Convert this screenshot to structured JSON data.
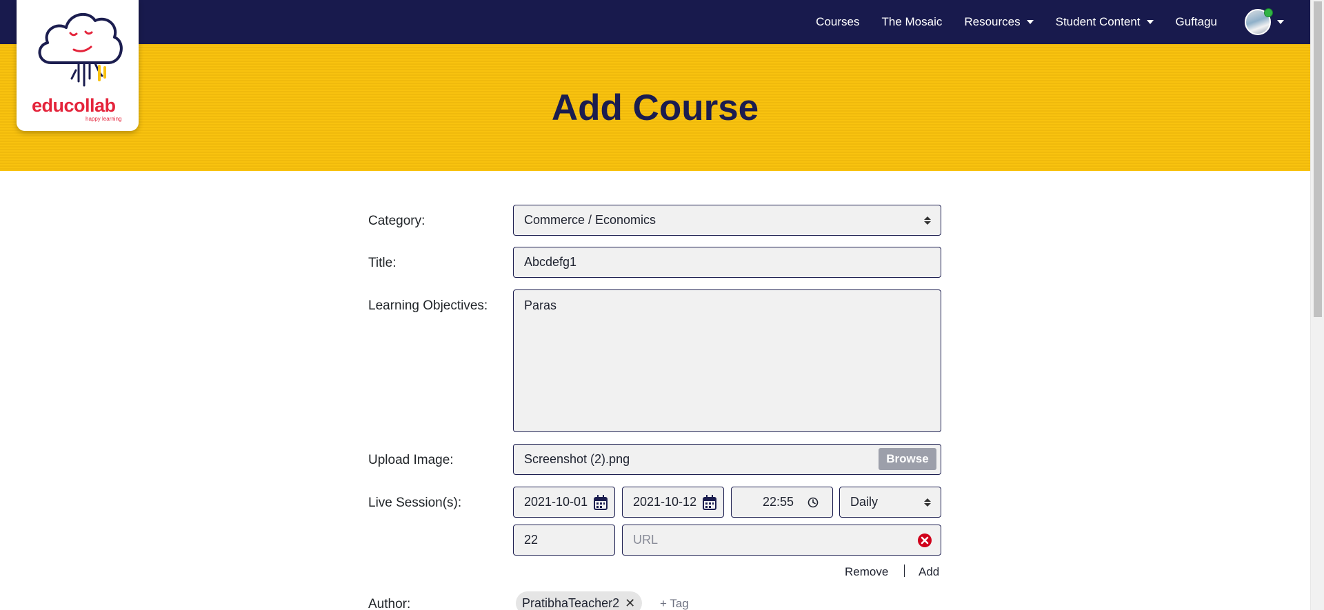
{
  "nav": {
    "items": [
      {
        "label": "Courses",
        "dropdown": false
      },
      {
        "label": "The Mosaic",
        "dropdown": false
      },
      {
        "label": "Resources",
        "dropdown": true
      },
      {
        "label": "Student Content",
        "dropdown": true
      },
      {
        "label": "Guftagu",
        "dropdown": false
      }
    ]
  },
  "logo": {
    "text": "educollab",
    "tagline": "happy learning"
  },
  "page": {
    "title": "Add Course"
  },
  "form": {
    "category": {
      "label": "Category:",
      "value": "Commerce / Economics"
    },
    "title": {
      "label": "Title:",
      "value": "Abcdefg1"
    },
    "objectives": {
      "label": "Learning Objectives:",
      "value": "Paras"
    },
    "upload": {
      "label": "Upload Image:",
      "value": "Screenshot (2).png",
      "button": "Browse"
    },
    "live_session": {
      "label": "Live Session(s):",
      "start_date": "2021-10-01",
      "end_date": "2021-10-12",
      "time": "22:55",
      "frequency": "Daily",
      "count": "22",
      "url_placeholder": "URL",
      "remove_label": "Remove",
      "add_label": "Add"
    },
    "author": {
      "label": "Author:",
      "tags": [
        "PratibhaTeacher2"
      ],
      "add_tag": "+ Tag"
    }
  },
  "colors": {
    "navbar": "#181a4d",
    "banner": "#f8c20f",
    "title": "#1b1d4f",
    "logo": "#e4243b",
    "remove_icon": "#d0021b"
  }
}
